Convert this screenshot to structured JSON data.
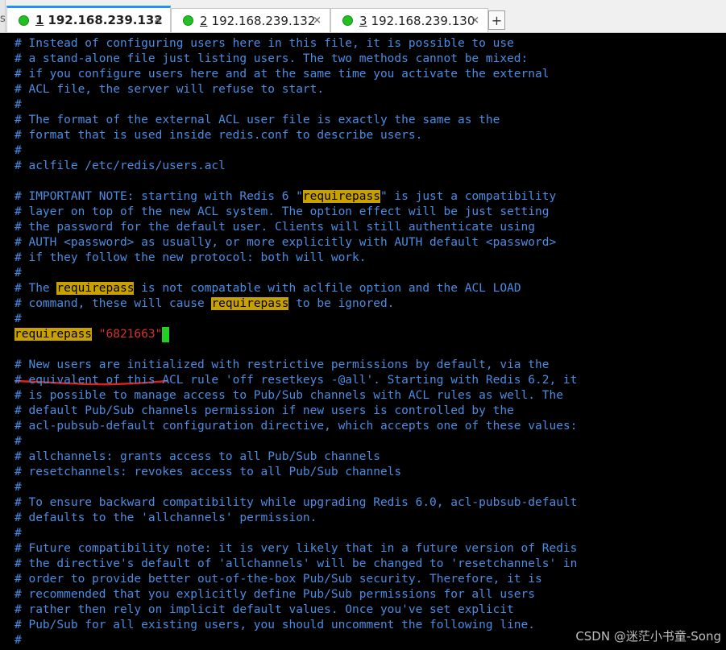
{
  "tabs": [
    {
      "num": "1",
      "host": "192.168.239.132",
      "active": true
    },
    {
      "num": "2",
      "host": "192.168.239.132",
      "active": false
    },
    {
      "num": "3",
      "host": "192.168.239.130",
      "active": false
    }
  ],
  "add_tab_label": "+",
  "left_strip_glyph": "s",
  "close_glyph": "✕",
  "lines": [
    "# Instead of configuring users here in this file, it is possible to use",
    "# a stand-alone file just listing users. The two methods cannot be mixed:",
    "# if you configure users here and at the same time you activate the external",
    "# ACL file, the server will refuse to start.",
    "#",
    "# The format of the external ACL user file is exactly the same as the",
    "# format that is used inside redis.conf to describe users.",
    "#",
    "# aclfile /etc/redis/users.acl",
    "",
    "# IMPORTANT NOTE: starting with Redis 6 \"requirepass\" is just a compatibility",
    "# layer on top of the new ACL system. The option effect will be just setting",
    "# the password for the default user. Clients will still authenticate using",
    "# AUTH <password> as usually, or more explicitly with AUTH default <password>",
    "# if they follow the new protocol: both will work.",
    "#",
    "# The requirepass is not compatable with aclfile option and the ACL LOAD",
    "# command, these will cause requirepass to be ignored.",
    "#",
    "requirepass \"6821663\"",
    "",
    "# New users are initialized with restrictive permissions by default, via the",
    "# equivalent of this ACL rule 'off resetkeys -@all'. Starting with Redis 6.2, it",
    "# is possible to manage access to Pub/Sub channels with ACL rules as well. The",
    "# default Pub/Sub channels permission if new users is controlled by the",
    "# acl-pubsub-default configuration directive, which accepts one of these values:",
    "#",
    "# allchannels: grants access to all Pub/Sub channels",
    "# resetchannels: revokes access to all Pub/Sub channels",
    "#",
    "# To ensure backward compatibility while upgrading Redis 6.0, acl-pubsub-default",
    "# defaults to the 'allchannels' permission.",
    "#",
    "# Future compatibility note: it is very likely that in a future version of Redis",
    "# the directive's default of 'allchannels' will be changed to 'resetchannels' in",
    "# order to provide better out-of-the-box Pub/Sub security. Therefore, it is",
    "# recommended that you explicitly define Pub/Sub permissions for all users",
    "# rather then rely on implicit default values. Once you've set explicit",
    "# Pub/Sub for all existing users, you should uncomment the following line.",
    "#"
  ],
  "highlight_word": "requirepass",
  "config_line": {
    "key": "requirepass",
    "value": "\"6821663\""
  },
  "watermark": "CSDN @迷茫小书童-Song",
  "colors": {
    "comment": "#4a8de3",
    "highlight_bg": "#c8a000",
    "string": "#d83030",
    "cursor": "#22d022",
    "annotation": "#e02020",
    "tab_dot": "#22c022",
    "active_tab_accent": "#1e90ff"
  }
}
